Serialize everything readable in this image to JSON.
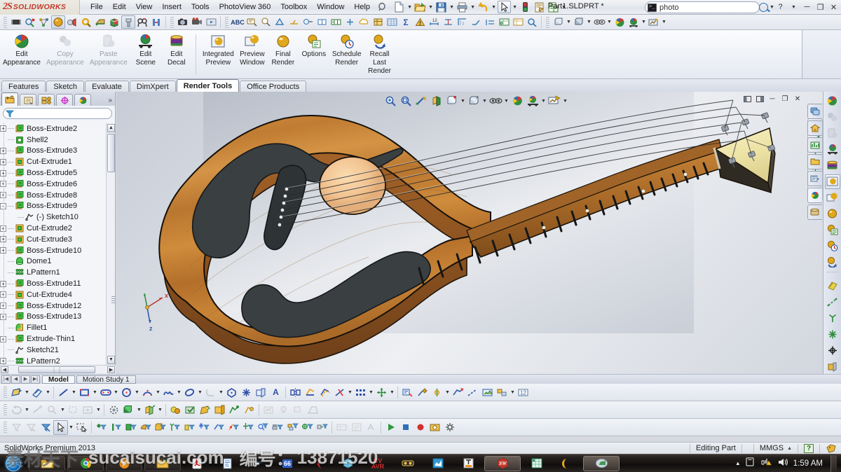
{
  "app": {
    "brand_ds": "2S",
    "brand_name": "SOLIDWORKS",
    "document_title": "Part1.SLDPRT *",
    "status_product": "SolidWorks Premium 2013",
    "status_mode": "Editing Part",
    "status_units": "MMGS",
    "accent_blue": "#2f6fb5",
    "wood_body": "#c9833a",
    "wood_dark": "#a2602a",
    "pickguard": "#3a3f42"
  },
  "menu": {
    "items": [
      "File",
      "Edit",
      "View",
      "Insert",
      "Tools",
      "PhotoView 360",
      "Toolbox",
      "Window",
      "Help"
    ],
    "quick_icons": [
      {
        "name": "new-document-icon",
        "caret": true
      },
      {
        "name": "open-folder-icon",
        "caret": true
      },
      {
        "name": "save-icon",
        "caret": true
      },
      {
        "name": "print-icon",
        "caret": true
      },
      {
        "name": "undo-icon",
        "caret": true
      },
      {
        "name": "select-arrow-icon",
        "caret": true
      },
      {
        "name": "rebuild-icon",
        "caret": false
      },
      {
        "name": "options-icon",
        "caret": false
      },
      {
        "name": "file-properties-icon",
        "caret": true
      }
    ],
    "window_buttons": [
      "minimize",
      "restore",
      "close"
    ]
  },
  "search": {
    "value": "photo",
    "placeholder": "Search",
    "icon": "command-search-icon"
  },
  "toolstrip": {
    "groups": [
      [
        "insert-component-icon",
        "mate-icon",
        "assembly-features-icon",
        "appearance-sphere-icon",
        "lighting-icon",
        "decal-icon",
        "section-view-icon",
        "display-state-icon",
        "extrude-boss-icon",
        "measure-icon",
        "interference-icon"
      ],
      [
        "photoview-camera-icon",
        "motion-study-icon",
        "animation-icon"
      ],
      [
        "abc-spellcheck-icon",
        "annotation-note-icon",
        "balloon-icon",
        "surface-finish-icon",
        "weld-symbol-icon",
        "hole-callout-icon",
        "datum-icon",
        "geometric-tolerance-icon",
        "center-mark-icon",
        "revision-cloud-icon",
        "block-icon",
        "table-icon",
        "sum-icon",
        "sigma-icon",
        "warning-icon",
        "dim-icon",
        "smart-dim-icon",
        "auto-dim-icon",
        "ordinate-icon",
        "chamfer-dim-icon",
        "baseline-icon",
        "hole-table-icon",
        "bom-icon",
        "magnify-icon"
      ],
      [
        "view-orientation-icon",
        "display-style-icon",
        "hide-show-icon",
        "section-icon",
        "scene-icon",
        "zoom-fit-icon",
        "rotate-view-icon"
      ],
      [
        "standard-views-icon",
        "previous-view-icon",
        "view-palette-icon"
      ]
    ]
  },
  "ribbon": {
    "tab": "Render Tools",
    "buttons": [
      {
        "label": "Edit\nAppearance",
        "name": "edit-appearance-button",
        "icon": "appearance-sphere-icon",
        "disabled": false
      },
      {
        "label": "Copy\nAppearance",
        "name": "copy-appearance-button",
        "icon": "copy-appearance-icon",
        "disabled": true
      },
      {
        "label": "Paste\nAppearance",
        "name": "paste-appearance-button",
        "icon": "paste-appearance-icon",
        "disabled": true
      },
      {
        "label": "Edit\nScene",
        "name": "edit-scene-button",
        "icon": "scene-icon",
        "disabled": false
      },
      {
        "label": "Edit\nDecal",
        "name": "edit-decal-button",
        "icon": "decal-icon",
        "disabled": false
      },
      {
        "sep": true
      },
      {
        "label": "Integrated\nPreview",
        "name": "integrated-preview-button",
        "icon": "integrated-preview-icon",
        "disabled": false
      },
      {
        "label": "Preview\nWindow",
        "name": "preview-window-button",
        "icon": "preview-window-icon",
        "disabled": false
      },
      {
        "label": "Final\nRender",
        "name": "final-render-button",
        "icon": "final-render-icon",
        "disabled": false
      },
      {
        "label": "Options",
        "name": "render-options-button",
        "icon": "render-options-icon",
        "disabled": false
      },
      {
        "label": "Schedule\nRender",
        "name": "schedule-render-button",
        "icon": "schedule-render-icon",
        "disabled": false
      },
      {
        "label": "Recall\nLast\nRender",
        "name": "recall-last-render-button",
        "icon": "recall-render-icon",
        "disabled": false
      }
    ],
    "labels": {
      "edit_appearance_l1": "Edit",
      "edit_appearance_l2": "Appearance",
      "copy_appearance_l1": "Copy",
      "copy_appearance_l2": "Appearance",
      "paste_appearance_l1": "Paste",
      "paste_appearance_l2": "Appearance",
      "edit_scene_l1": "Edit",
      "edit_scene_l2": "Scene",
      "edit_decal_l1": "Edit",
      "edit_decal_l2": "Decal",
      "integrated_preview_l1": "Integrated",
      "integrated_preview_l2": "Preview",
      "preview_window_l1": "Preview",
      "preview_window_l2": "Window",
      "final_render_l1": "Final",
      "final_render_l2": "Render",
      "options_l1": "Options",
      "schedule_render_l1": "Schedule",
      "schedule_render_l2": "Render",
      "recall_l1": "Recall",
      "recall_l2": "Last",
      "recall_l3": "Render"
    }
  },
  "command_tabs": [
    {
      "label": "Features",
      "active": false
    },
    {
      "label": "Sketch",
      "active": false
    },
    {
      "label": "Evaluate",
      "active": false
    },
    {
      "label": "DimXpert",
      "active": false
    },
    {
      "label": "Render Tools",
      "active": true
    },
    {
      "label": "Office Products",
      "active": false
    }
  ],
  "feature_manager": {
    "tabs": [
      {
        "name": "featuremanager-tree-tab",
        "icon": "feature-tree-icon",
        "active": true
      },
      {
        "name": "property-manager-tab",
        "icon": "property-manager-icon",
        "active": false
      },
      {
        "name": "configuration-manager-tab",
        "icon": "configuration-icon",
        "active": false
      },
      {
        "name": "dimxpert-manager-tab",
        "icon": "dimxpert-icon",
        "active": false
      },
      {
        "name": "display-manager-tab",
        "icon": "display-manager-icon",
        "active": false
      }
    ],
    "more_label": "»",
    "filter_placeholder": "",
    "tree": [
      {
        "label": "Boss-Extrude2",
        "icon": "boss-extrude-icon",
        "expand": "+",
        "indent": 0
      },
      {
        "label": "Shell2",
        "icon": "shell-icon",
        "expand": "",
        "indent": 0
      },
      {
        "label": "Boss-Extrude3",
        "icon": "boss-extrude-icon",
        "expand": "+",
        "indent": 0
      },
      {
        "label": "Cut-Extrude1",
        "icon": "cut-extrude-icon",
        "expand": "+",
        "indent": 0
      },
      {
        "label": "Boss-Extrude5",
        "icon": "boss-extrude-icon",
        "expand": "+",
        "indent": 0
      },
      {
        "label": "Boss-Extrude6",
        "icon": "boss-extrude-icon",
        "expand": "+",
        "indent": 0
      },
      {
        "label": "Boss-Extrude8",
        "icon": "boss-extrude-icon",
        "expand": "+",
        "indent": 0
      },
      {
        "label": "Boss-Extrude9",
        "icon": "boss-extrude-icon",
        "expand": "-",
        "indent": 0
      },
      {
        "label": "(-) Sketch10",
        "icon": "sketch-icon",
        "expand": "",
        "indent": 1
      },
      {
        "label": "Cut-Extrude2",
        "icon": "cut-extrude-icon",
        "expand": "+",
        "indent": 0
      },
      {
        "label": "Cut-Extrude3",
        "icon": "cut-extrude-icon",
        "expand": "+",
        "indent": 0
      },
      {
        "label": "Boss-Extrude10",
        "icon": "boss-extrude-icon",
        "expand": "+",
        "indent": 0
      },
      {
        "label": "Dome1",
        "icon": "dome-icon",
        "expand": "",
        "indent": 0
      },
      {
        "label": "LPattern1",
        "icon": "lpattern-icon",
        "expand": "",
        "indent": 0
      },
      {
        "label": "Boss-Extrude11",
        "icon": "boss-extrude-icon",
        "expand": "+",
        "indent": 0
      },
      {
        "label": "Cut-Extrude4",
        "icon": "cut-extrude-icon",
        "expand": "+",
        "indent": 0
      },
      {
        "label": "Boss-Extrude12",
        "icon": "boss-extrude-icon",
        "expand": "+",
        "indent": 0
      },
      {
        "label": "Boss-Extrude13",
        "icon": "boss-extrude-icon",
        "expand": "+",
        "indent": 0
      },
      {
        "label": "Fillet1",
        "icon": "fillet-icon",
        "expand": "",
        "indent": 0
      },
      {
        "label": "Extrude-Thin1",
        "icon": "boss-extrude-icon",
        "expand": "+",
        "indent": 0
      },
      {
        "label": "Sketch21",
        "icon": "sketch-icon",
        "expand": "",
        "indent": 0
      },
      {
        "label": "LPattern2",
        "icon": "lpattern-icon",
        "expand": "+",
        "indent": 0
      }
    ]
  },
  "viewport": {
    "toolbar_icons": [
      "zoom-to-fit-icon",
      "zoom-to-area-icon",
      "previous-view-icon",
      "section-view-icon",
      "view-orientation-icon",
      "display-style-icon",
      "hide-show-items-icon",
      "appearances-icon",
      "scene-apply-icon",
      "view-settings-icon"
    ],
    "window_buttons": [
      "split-left",
      "split-right",
      "minimize",
      "restore",
      "close"
    ],
    "triad_labels": {
      "x": "x",
      "y": "y",
      "z": "z"
    },
    "model_name": "acoustic-guitar-model",
    "right_toolbar_icons": [
      "appearance-icon",
      "dashed-line-icon",
      "axis-icon",
      "origin-icon",
      "point-icon",
      "plane-icon"
    ]
  },
  "task_pane": {
    "tabs": [
      "solidworks-resources-icon",
      "design-library-icon",
      "file-explorer-icon",
      "view-palette-icon",
      "appearances-scenes-icon",
      "custom-properties-icon"
    ],
    "strip_icons": [
      "appearance-sphere-icon",
      "copy-appearance-icon",
      "paste-appearance-icon",
      "edit-scene-icon",
      "edit-decal-icon",
      "integrated-preview-icon",
      "preview-window-icon",
      "final-render-icon",
      "render-options-icon",
      "schedule-render-icon",
      "recall-render-icon",
      "appearance-gold-icon",
      "line-format-icon",
      "axis-icon",
      "star-icon",
      "origin-icon",
      "plane-icon"
    ]
  },
  "model_tabs": {
    "nav": [
      "◀◀",
      "◀",
      "▶",
      "▶▶"
    ],
    "tabs": [
      {
        "label": "Model",
        "active": true
      },
      {
        "label": "Motion Study 1",
        "active": false
      }
    ]
  },
  "bottom_toolbars": {
    "row1": [
      "sketch-icon",
      "smart-dimension-icon",
      "line-icon",
      "rectangle-icon",
      "slot-icon",
      "circle-icon",
      "arc-icon",
      "spline-icon",
      "ellipse-icon",
      "fillet-icon",
      "polygon-icon",
      "point-icon",
      "plane-icon",
      "text-icon",
      "mirror-icon",
      "convert-entities-icon",
      "offset-entities-icon",
      "trim-icon",
      "pattern-icon",
      "move-icon",
      "display-delete-relation-icon",
      "repair-sketch-icon",
      "quick-snaps-icon",
      "rapid-sketch-icon",
      "construction-geometry-icon",
      "3d-sketch-icon",
      "sketch-picture-icon",
      "blocks-icon",
      "sketch-numeric-icon"
    ],
    "row2": [
      "rotate-view-icon",
      "pan-icon",
      "zoom-in-out-icon",
      "zoom-to-area-icon",
      "zoom-to-fit-icon",
      "rotate-icon",
      "roll-view-icon",
      "turn-view-icon",
      "3d-drawing-view-icon",
      "standard-views-icon",
      "section-view-icon",
      "display-style-icon",
      "hide-show-icon",
      "appearance-icon",
      "scenes-icon",
      "camera-icon",
      "walk-through-icon",
      "view-setting-icon",
      "lights-icon",
      "shadow-icon",
      "perspective-icon"
    ],
    "row3": [
      "filter-off-icon",
      "filter-faces-icon",
      "filter-edges-icon",
      "select-arrow-icon",
      "select-dropdown-icon",
      "box-select-icon",
      "vertex-filter-icon",
      "edge-filter-icon",
      "face-filter-icon",
      "surface-filter-icon",
      "solid-filter-icon",
      "axis-filter-icon",
      "plane-filter-icon",
      "sketch-point-filter-icon",
      "sketch-segment-filter-icon",
      "midpoint-filter-icon",
      "center-mark-filter-icon",
      "dimension-filter-icon",
      "weld-bead-filter-icon",
      "blocks-filter-icon",
      "connection-point-filter-icon",
      "route-point-filter-icon",
      "table-filter-icon",
      "note-filter-icon",
      "play-icon",
      "stop-icon",
      "record-icon",
      "capture-icon",
      "settings-icon"
    ]
  },
  "status": {
    "product": "SolidWorks Premium 2013",
    "mode": "Editing Part",
    "units": "MMGS",
    "units_caret": "▲",
    "help_badge": "?"
  },
  "taskbar": {
    "start": "start-orb",
    "buttons": [
      {
        "name": "windows-explorer-task",
        "icon": "folder-icon",
        "active": false
      },
      {
        "name": "chrome-task",
        "icon": "chrome-icon",
        "active": false
      },
      {
        "name": "media-player-task",
        "icon": "media-icon",
        "active": false
      },
      {
        "name": "notes-task",
        "icon": "notes-icon",
        "active": false
      },
      {
        "name": "acrobat-task",
        "icon": "pdf-icon",
        "active": false
      },
      {
        "name": "document-task",
        "icon": "doc-icon",
        "active": false
      },
      {
        "name": "app-task",
        "icon": "app-icon",
        "active": false
      },
      {
        "name": "66-task",
        "icon": "number-icon",
        "active": false
      },
      {
        "name": "red-app-task",
        "icon": "red-icon",
        "active": false
      },
      {
        "name": "cube-task",
        "icon": "cube-icon",
        "active": false
      },
      {
        "name": "cvavr-task",
        "icon": "cvavr-icon",
        "active": false
      },
      {
        "name": "tape-task",
        "icon": "tape-icon",
        "active": false
      },
      {
        "name": "paint-task",
        "icon": "paint-icon",
        "active": false
      },
      {
        "name": "text-task",
        "icon": "text-icon",
        "active": false
      },
      {
        "name": "solidworks-task",
        "icon": "solidworks-icon",
        "active": true
      },
      {
        "name": "excel-task",
        "icon": "excel-icon",
        "active": false
      },
      {
        "name": "opera-task",
        "icon": "opera-icon",
        "active": false
      },
      {
        "name": "explorer2-task",
        "icon": "explorer-icon",
        "active": true
      }
    ],
    "tray": {
      "show_hidden": "▲",
      "icons": [
        "network-icon",
        "volume-icon"
      ],
      "time": "1:59 AM"
    }
  },
  "watermark": {
    "part1": "素材天下",
    "part2": "sucaisucai.com",
    "part3": "编号：",
    "part4": "13871520"
  }
}
